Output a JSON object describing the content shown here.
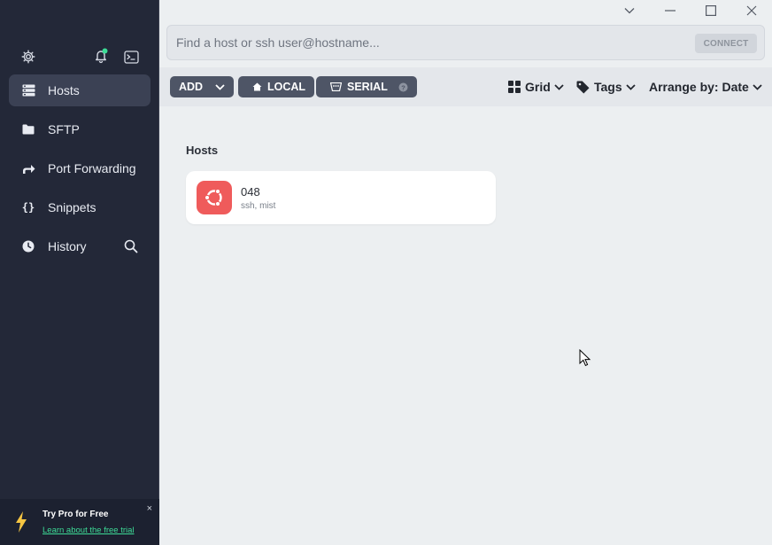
{
  "window": {
    "controls": [
      "chevron-down",
      "minimize",
      "maximize",
      "close"
    ]
  },
  "sidebar": {
    "items": [
      {
        "label": "Hosts",
        "icon": "hosts-icon",
        "active": true
      },
      {
        "label": "SFTP",
        "icon": "folder-icon",
        "active": false
      },
      {
        "label": "Port Forwarding",
        "icon": "port-forward-icon",
        "active": false
      },
      {
        "label": "Snippets",
        "icon": "braces-icon",
        "active": false
      },
      {
        "label": "History",
        "icon": "clock-icon",
        "active": false
      }
    ],
    "promo": {
      "title": "Try Pro for Free",
      "link": "Learn about the free trial",
      "close": "×"
    }
  },
  "search": {
    "placeholder": "Find a host or ssh user@hostname...",
    "value": "",
    "connect_label": "CONNECT"
  },
  "toolbar": {
    "add_label": "ADD",
    "local_label": "LOCAL",
    "serial_label": "SERIAL",
    "view_label": "Grid",
    "tags_label": "Tags",
    "arrange_label": "Arrange by: Date"
  },
  "main": {
    "section_title": "Hosts",
    "hosts": [
      {
        "name": "048",
        "subtitle": "ssh, mist",
        "icon": "ubuntu-icon"
      }
    ]
  },
  "colors": {
    "sidebar_bg": "#232838",
    "accent_green": "#3ddc97",
    "host_icon_bg": "#ef5b5b"
  }
}
